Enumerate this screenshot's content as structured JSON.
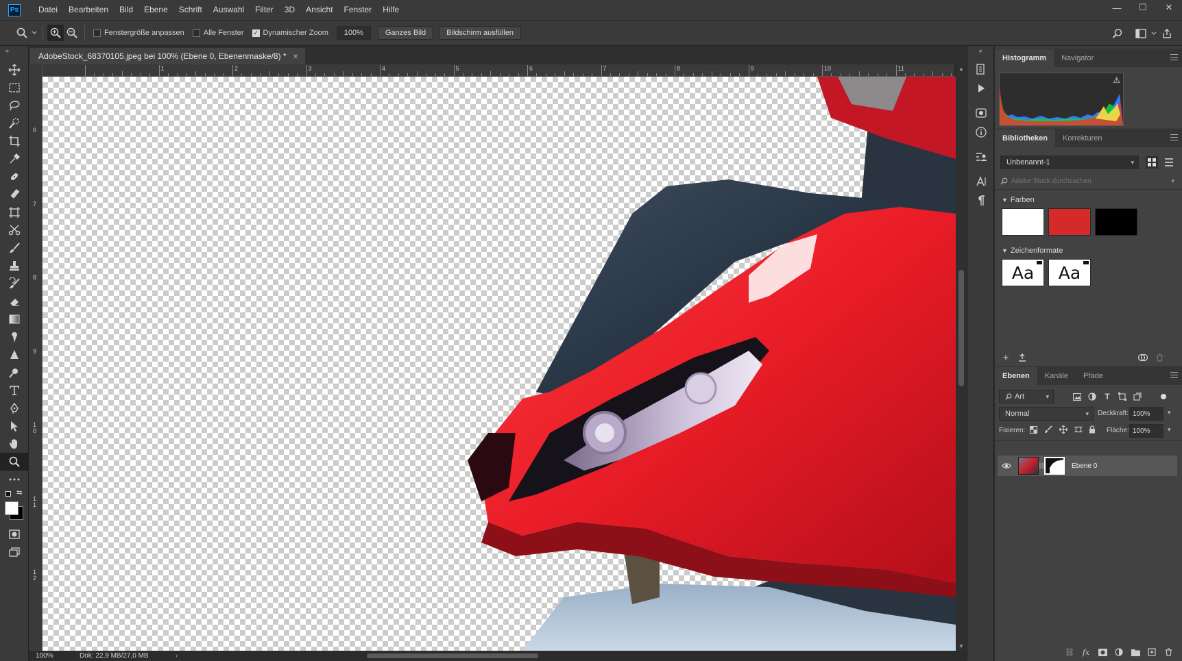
{
  "app": {
    "logo_text": "Ps"
  },
  "menu": [
    "Datei",
    "Bearbeiten",
    "Bild",
    "Ebene",
    "Schrift",
    "Auswahl",
    "Filter",
    "3D",
    "Ansicht",
    "Fenster",
    "Hilfe"
  ],
  "window_controls": {
    "minimize": "—",
    "maximize": "☐",
    "close": "✕"
  },
  "options": {
    "fit_window_label": "Fenstergröße anpassen",
    "fit_window_checked": false,
    "all_windows_label": "Alle Fenster",
    "all_windows_checked": false,
    "dynamic_zoom_label": "Dynamischer Zoom",
    "dynamic_zoom_checked": true,
    "zoom_value": "100%",
    "fit_screen_label": "Ganzes Bild",
    "fill_screen_label": "Bildschirm ausfüllen"
  },
  "document": {
    "tab_title": "AdobeStock_68370105.jpeg bei 100% (Ebene 0, Ebenenmaske/8) *",
    "close": "×"
  },
  "rulers": {
    "top_labels": [
      "1",
      "2",
      "3",
      "4",
      "5",
      "6",
      "7",
      "8",
      "9",
      "10",
      "11"
    ],
    "left_labels": [
      "6",
      "7",
      "8",
      "9",
      "1\n0",
      "1\n1",
      "1\n2"
    ]
  },
  "status": {
    "zoom": "100%",
    "doc_info": "Dok: 22,9 MB/27,0 MB",
    "arrow": "›"
  },
  "panels": {
    "histogram": {
      "tabs": [
        "Histogramm",
        "Navigator"
      ],
      "warning": "⚠"
    },
    "libraries": {
      "tabs": [
        "Bibliotheken",
        "Korrekturen"
      ],
      "library_name": "Unbenannt-1",
      "search_placeholder": "Adobe Stock durchsuchen",
      "colors_heading": "Farben",
      "colors": [
        "#ffffff",
        "#d42a2a",
        "#000000"
      ],
      "char_styles_heading": "Zeichenformate",
      "char_styles": [
        "Aa",
        "Aa"
      ]
    },
    "layers": {
      "tabs": [
        "Ebenen",
        "Kanäle",
        "Pfade"
      ],
      "filter_kind": "Art",
      "blend_mode": "Normal",
      "opacity_label": "Deckkraft:",
      "opacity_value": "100%",
      "lock_label": "Fixieren:",
      "fill_label": "Fläche:",
      "fill_value": "100%",
      "layer_name": "Ebene 0"
    }
  }
}
